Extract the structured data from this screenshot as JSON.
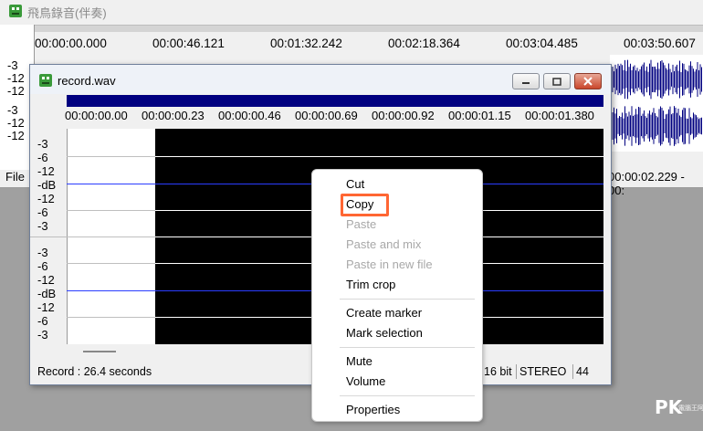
{
  "background_window": {
    "title": "飛鳥錄音(伴奏)",
    "ruler_ticks": [
      "00:00:00.000",
      "00:00:46.121",
      "00:01:32.242",
      "00:02:18.364",
      "00:03:04.485",
      "00:03:50.607"
    ],
    "db_labels": [
      "-3",
      "-12",
      "-12",
      "-3",
      "-12",
      "-12"
    ],
    "file_menu": "File",
    "time_readout": "00:00:02.229 - 00:"
  },
  "window": {
    "title": "record.wav",
    "ruler_ticks": [
      "00:00:00.00",
      "00:00:00.23",
      "00:00:00.46",
      "00:00:00.69",
      "00:00:00.92",
      "00:00:01.15",
      "00:00:01.380"
    ],
    "channel1_db": [
      "-3",
      "-6",
      "-12",
      "-dB",
      "-12",
      "-6",
      "-3"
    ],
    "channel2_db": [
      "-3",
      "-6",
      "-12",
      "-dB",
      "-12",
      "-6",
      "-3"
    ],
    "status": {
      "record_text": "Record : 26.4 seconds",
      "bit_depth": "16 bit",
      "channels": "STEREO",
      "rate": "44"
    }
  },
  "context_menu": {
    "items": [
      {
        "label": "Cut",
        "enabled": true
      },
      {
        "label": "Copy",
        "enabled": true
      },
      {
        "label": "Paste",
        "enabled": false
      },
      {
        "label": "Paste and mix",
        "enabled": false
      },
      {
        "label": "Paste in new file",
        "enabled": false
      },
      {
        "label": "Trim crop",
        "enabled": true
      },
      {
        "label": "Create marker",
        "enabled": true
      },
      {
        "label": "Mark selection",
        "enabled": true
      },
      {
        "label": "Mute",
        "enabled": true
      },
      {
        "label": "Volume",
        "enabled": true
      },
      {
        "label": "Properties",
        "enabled": true
      }
    ],
    "highlighted_item": "Copy",
    "highlight_color": "#ff6633"
  },
  "watermark": {
    "logo_text": "PK",
    "sub_text": "電腦王阿達"
  },
  "colors": {
    "waveform": "#000080",
    "selection": "#000000",
    "close_button": "#c9462b"
  }
}
